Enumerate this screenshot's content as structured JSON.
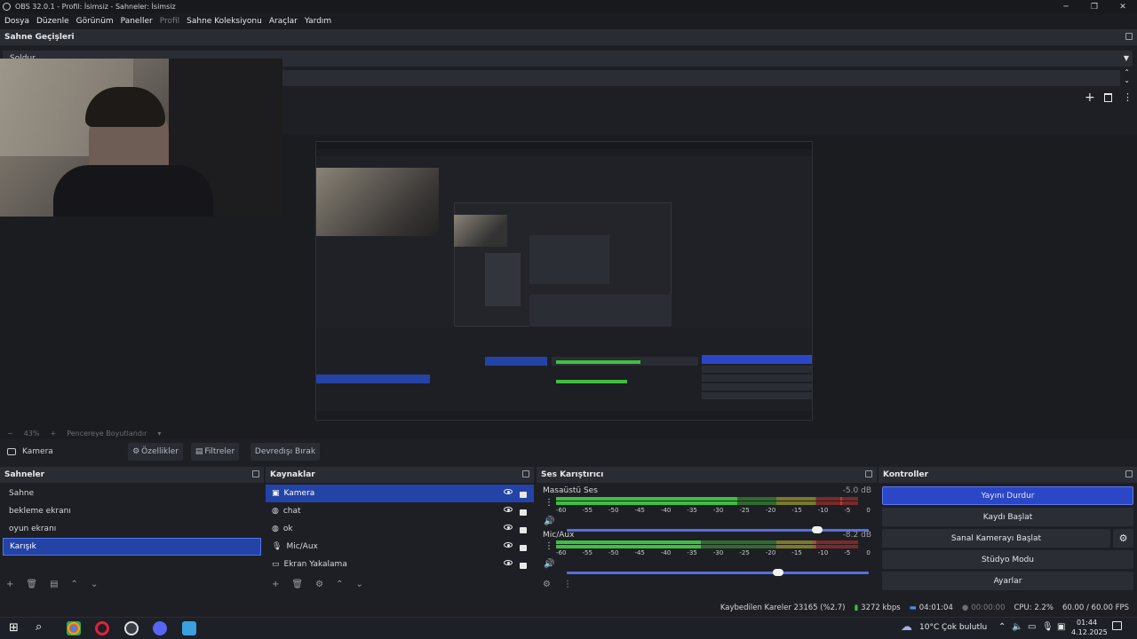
{
  "window": {
    "title": "OBS 32.0.1 - Profil: İsimsiz - Sahneler: İsimsiz"
  },
  "menu": [
    {
      "label": "Dosya",
      "enabled": true
    },
    {
      "label": "Düzenle",
      "enabled": true
    },
    {
      "label": "Görünüm",
      "enabled": true
    },
    {
      "label": "Paneller",
      "enabled": true
    },
    {
      "label": "Profil",
      "enabled": false
    },
    {
      "label": "Sahne Koleksiyonu",
      "enabled": true
    },
    {
      "label": "Araçlar",
      "enabled": true
    },
    {
      "label": "Yardım",
      "enabled": true
    }
  ],
  "transitions": {
    "title": "Sahne Geçişleri",
    "selected": "Soldur"
  },
  "zoom": {
    "percent": "43%",
    "mode": "Pencereye Boyutlandır"
  },
  "source_toolbar": {
    "selected_source": "Kamera",
    "properties": "Özellikler",
    "filters": "Filtreler",
    "deactivate": "Devredışı Bırak"
  },
  "scenes": {
    "title": "Sahneler",
    "items": [
      {
        "label": "Sahne",
        "selected": false
      },
      {
        "label": "bekleme ekranı",
        "selected": false
      },
      {
        "label": "oyun ekranı",
        "selected": false
      },
      {
        "label": "Karışık",
        "selected": true
      }
    ]
  },
  "sources": {
    "title": "Kaynaklar",
    "items": [
      {
        "label": "Kamera",
        "icon": "camera-icon",
        "selected": true
      },
      {
        "label": "chat",
        "icon": "globe-icon",
        "selected": false
      },
      {
        "label": "ok",
        "icon": "globe-icon",
        "selected": false
      },
      {
        "label": "Mic/Aux",
        "icon": "microphone-icon",
        "selected": false
      },
      {
        "label": "Ekran Yakalama",
        "icon": "monitor-icon",
        "selected": false
      }
    ]
  },
  "mixer": {
    "title": "Ses Karıştırıcı",
    "channels": [
      {
        "name": "Masaüstü Ses",
        "db": "-5.0 dB",
        "level": 0.6,
        "peak": 0.94,
        "volume": 0.83
      },
      {
        "name": "Mic/Aux",
        "db": "-8.2 dB",
        "level": 0.48,
        "peak": 0.85,
        "volume": 0.7
      }
    ],
    "ticks": [
      "-60",
      "-55",
      "-50",
      "-45",
      "-40",
      "-35",
      "-30",
      "-25",
      "-20",
      "-15",
      "-10",
      "-5",
      "0"
    ]
  },
  "controls": {
    "title": "Kontroller",
    "stop_stream": "Yayını Durdur",
    "start_record": "Kaydı Başlat",
    "virtual_cam": "Sanal Kamerayı Başlat",
    "studio_mode": "Stüdyo Modu",
    "settings": "Ayarlar"
  },
  "status": {
    "dropped_frames": "Kaybedilen Kareler 23165 (%2.7)",
    "bitrate": "3272 kbps",
    "stream_time": "04:01:04",
    "record_time": "00:00:00",
    "cpu": "CPU: 2.2%",
    "fps": "60.00 / 60.00 FPS"
  },
  "taskbar": {
    "weather_temp": "10°C",
    "weather_desc": "Çok bulutlu",
    "time": "01:44",
    "date": "4.12.2025"
  },
  "colors": {
    "accent": "#2443a6",
    "meter_green": "#3fbf3f",
    "meter_yellow": "#c8c83a",
    "meter_red": "#c83a3a",
    "stop_button": "#2b47c8"
  }
}
